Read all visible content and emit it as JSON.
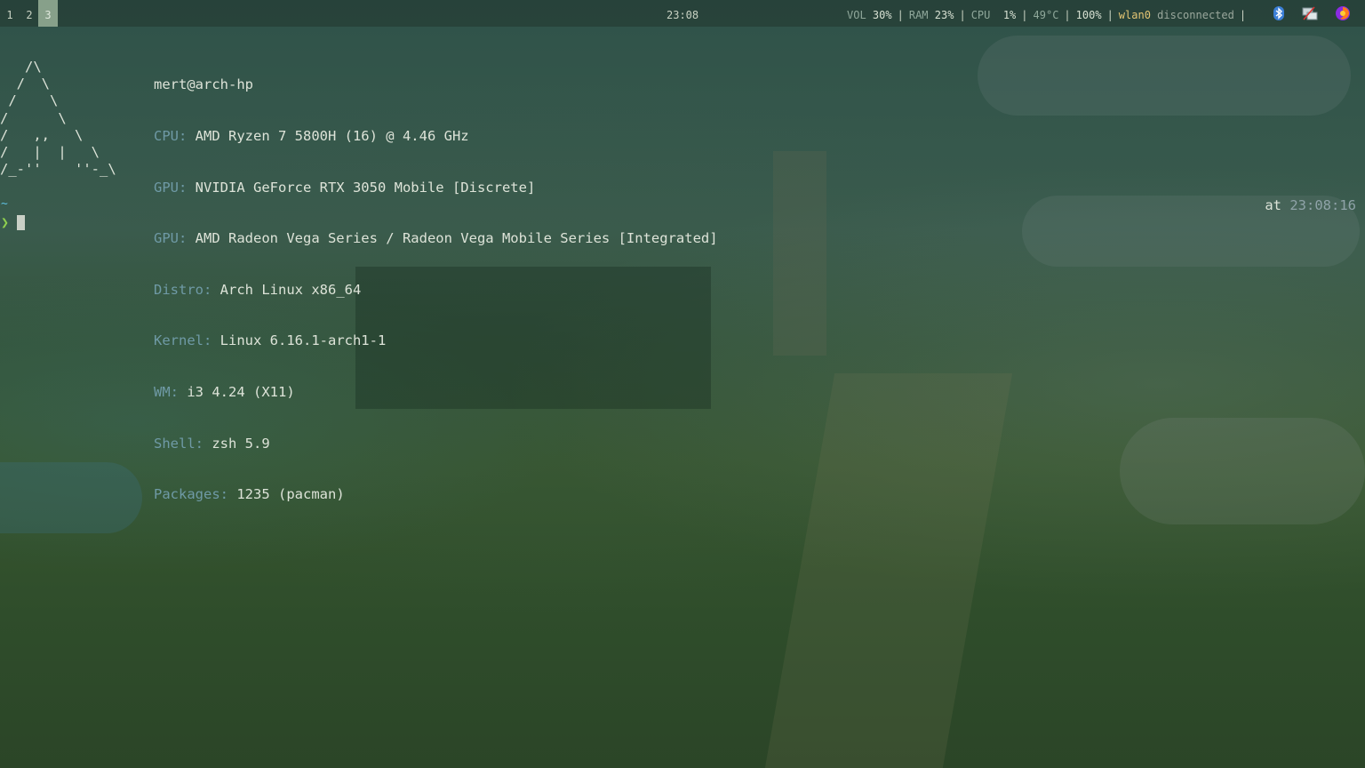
{
  "topbar": {
    "workspaces": [
      "1",
      "2",
      "3"
    ],
    "active_workspace": "3",
    "clock": "23:08",
    "status": {
      "vol_label": "VOL",
      "vol_value": "30%",
      "ram_label": "RAM",
      "ram_value": "23%",
      "cpu_label": "CPU",
      "cpu_value": "1%",
      "temp": "49°C",
      "battery": "100%",
      "wlan_name": "wlan0",
      "wlan_state": "disconnected",
      "separator": "|"
    },
    "tray_icons": [
      "bluetooth-icon",
      "network-manager-icon",
      "firefox-icon"
    ]
  },
  "terminal": {
    "logo": "   /\\\n  /  \\\n /    \\\n/      \\\n/   ,,   \\\n/   |  |   \\\n/_-''    ''-_\\",
    "user_host": "mert@arch-hp",
    "info": [
      {
        "key": "CPU:",
        "value": "AMD Ryzen 7 5800H (16) @ 4.46 GHz"
      },
      {
        "key": "GPU:",
        "value": "NVIDIA GeForce RTX 3050 Mobile [Discrete]"
      },
      {
        "key": "GPU:",
        "value": "AMD Radeon Vega Series / Radeon Vega Mobile Series [Integrated]"
      },
      {
        "key": "Distro:",
        "value": "Arch Linux x86_64"
      },
      {
        "key": "Kernel:",
        "value": "Linux 6.16.1-arch1-1"
      },
      {
        "key": "WM:",
        "value": "i3 4.24 (X11)"
      },
      {
        "key": "Shell:",
        "value": "zsh 5.9"
      },
      {
        "key": "Packages:",
        "value": "1235 (pacman)"
      }
    ],
    "cwd": "~",
    "prompt_symbol": "❯",
    "rprompt_prefix": "at",
    "rprompt_time": "23:08:16"
  },
  "colors": {
    "accent_workspace": "#87a08a",
    "info_key": "#6f9aa6",
    "prompt_green": "#8fd04f",
    "cwd_cyan": "#5ec1e0",
    "wlan_yellow": "#e3c574"
  }
}
